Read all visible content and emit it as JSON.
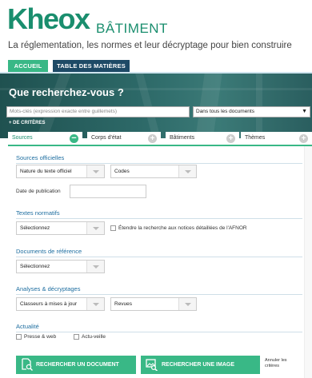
{
  "header": {
    "logo_text": "Kheox",
    "logo_sub": "BÂTIMENT",
    "tagline": "La réglementation, les normes et leur décryptage pour bien construire"
  },
  "nav": {
    "tabs": [
      {
        "label": "ACCUEIL"
      },
      {
        "label": "TABLE DES MATIÈRES"
      }
    ]
  },
  "search": {
    "title": "Que recherchez-vous ?",
    "placeholder": "Mots-clés (expression exacte entre guillemets)",
    "scope": "Dans tous les documents",
    "more_criteria": "+ DE CRITÈRES"
  },
  "filter_tabs": [
    {
      "label": "Sources"
    },
    {
      "label": "Corps d'état"
    },
    {
      "label": "Bâtiments"
    },
    {
      "label": "Thèmes"
    }
  ],
  "colors": {
    "brand_green": "#39b886",
    "nav_blue": "#1e4a66",
    "section_blue": "#1e6ea0"
  },
  "sections": {
    "sources_officielles": {
      "title": "Sources officielles",
      "nature": "Nature du texte officiel",
      "codes": "Codes",
      "date_label": "Date de publication",
      "date_value": ""
    },
    "textes_normatifs": {
      "title": "Textes normatifs",
      "select": "Sélectionnez",
      "checkbox_label": "Étendre la recherche aux notices détaillées de l'AFNOR"
    },
    "documents_reference": {
      "title": "Documents de référence",
      "select": "Sélectionnez"
    },
    "analyses": {
      "title": "Analyses & décryptages",
      "classeurs": "Classeurs à mises à jour",
      "revues": "Revues"
    },
    "actualite": {
      "title": "Actualité",
      "option1": "Presse & web",
      "option2": "Actu-veille"
    }
  },
  "actions": {
    "search_doc": "RECHERCHER UN DOCUMENT",
    "search_img": "RECHERCHER UNE IMAGE",
    "cancel": "Annuler les critères"
  }
}
